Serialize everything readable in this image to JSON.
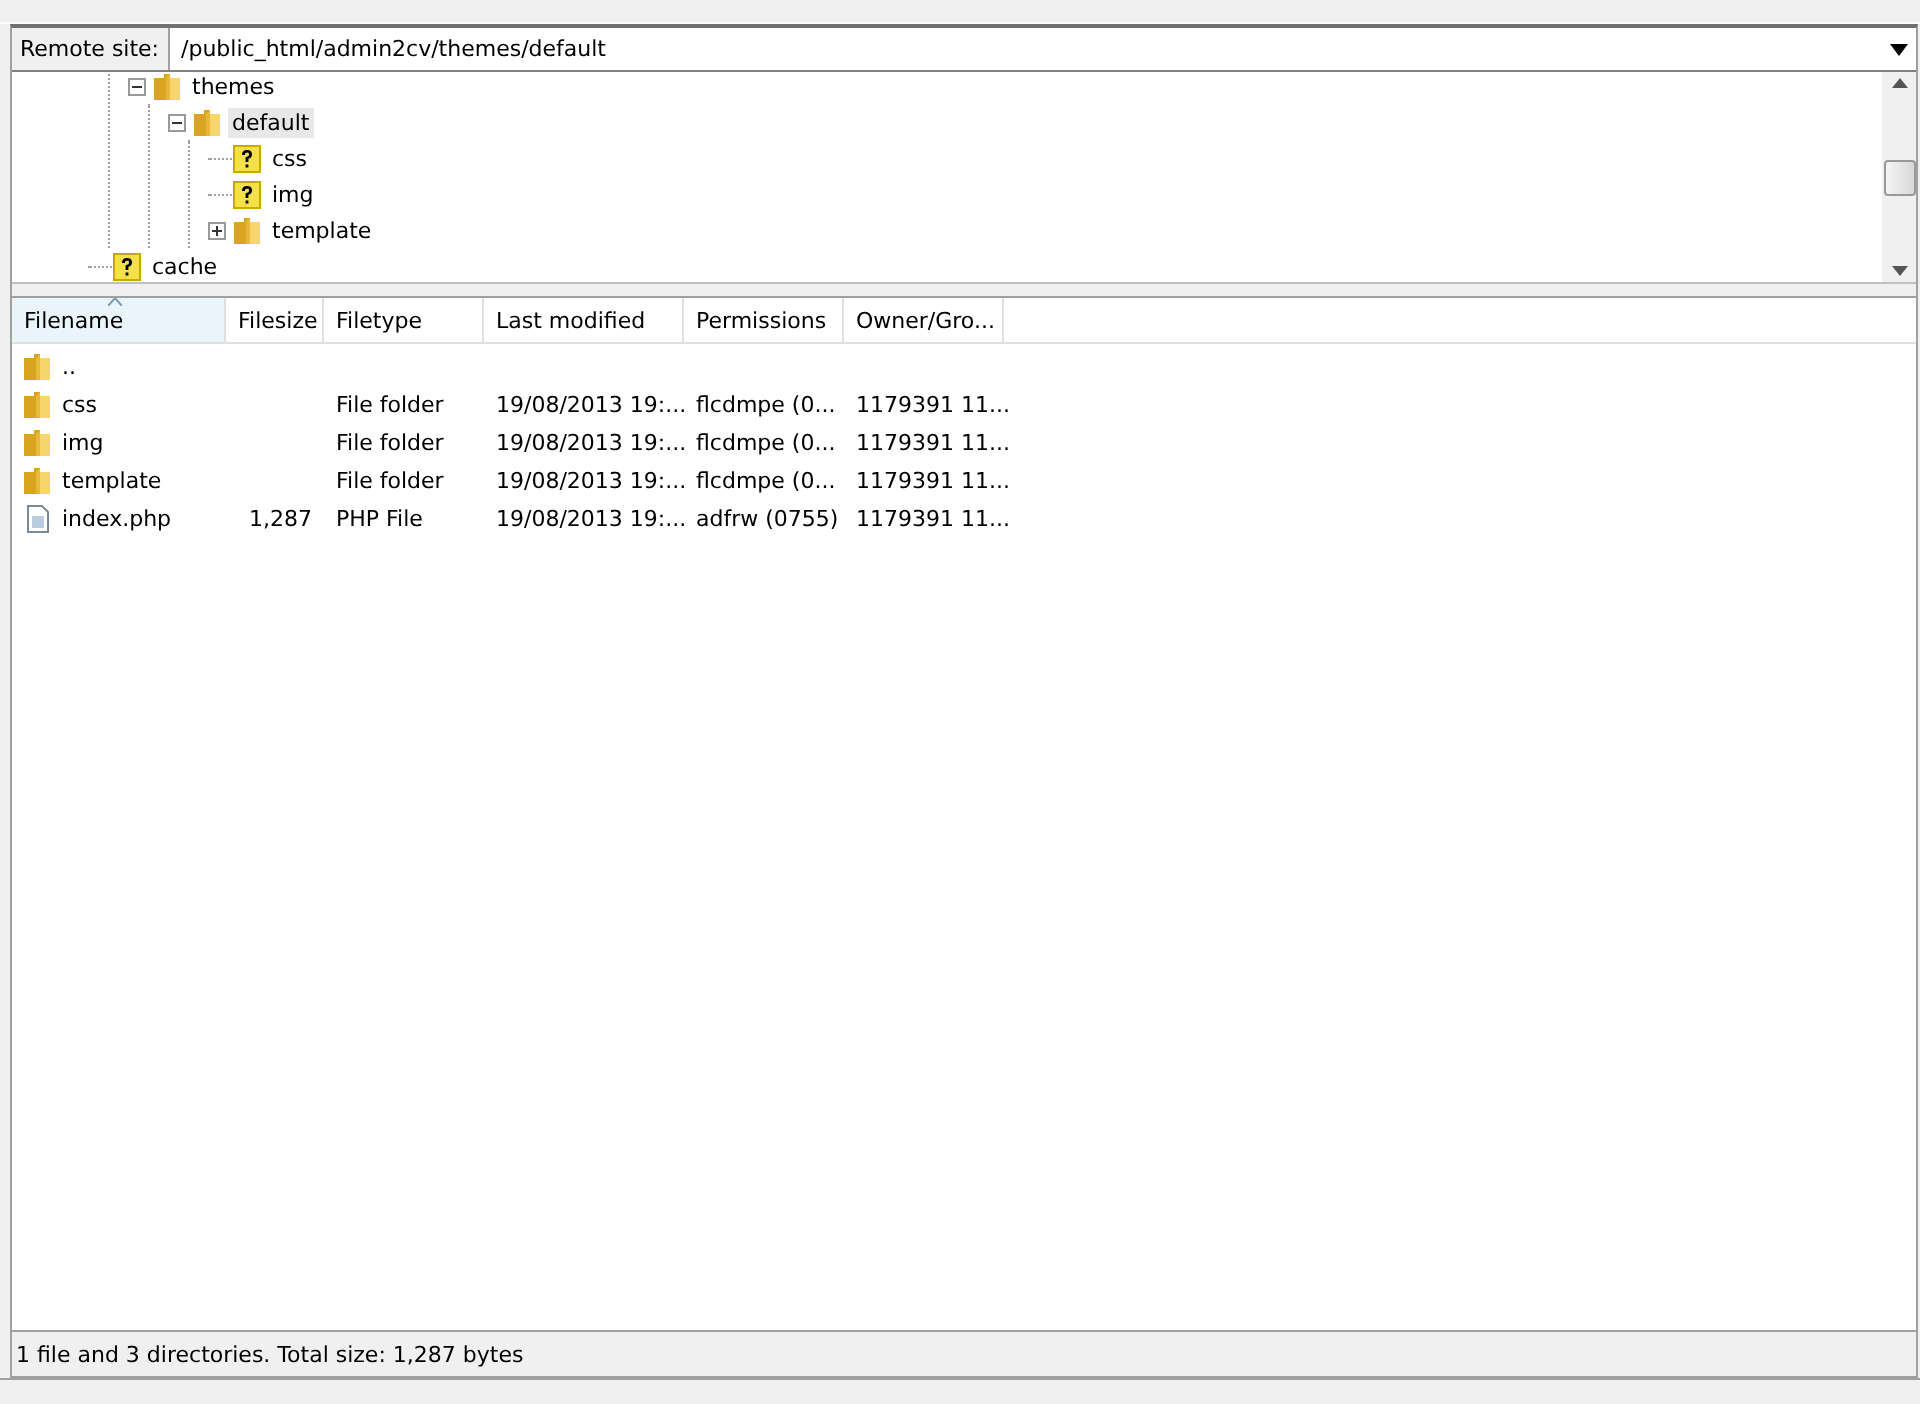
{
  "remote_site": {
    "label": "Remote site:",
    "path": "/public_html/admin2cv/themes/default"
  },
  "tree": {
    "items": [
      {
        "kind": "offscreen",
        "children": [
          {
            "label": "themes",
            "kind": "folder",
            "expanded": true,
            "selected": false,
            "children": [
              {
                "label": "default",
                "kind": "folder",
                "expanded": true,
                "selected": true,
                "children": [
                  {
                    "label": "css",
                    "kind": "unknown",
                    "selected": false
                  },
                  {
                    "label": "img",
                    "kind": "unknown",
                    "selected": false
                  },
                  {
                    "label": "template",
                    "kind": "folder",
                    "expanded": false,
                    "selected": false
                  }
                ]
              }
            ]
          }
        ]
      },
      {
        "label": "cache",
        "kind": "unknown",
        "selected": false
      }
    ]
  },
  "file_list": {
    "columns": [
      {
        "label": "Filename",
        "sorted": true
      },
      {
        "label": "Filesize",
        "sorted": false
      },
      {
        "label": "Filetype",
        "sorted": false
      },
      {
        "label": "Last modified",
        "sorted": false
      },
      {
        "label": "Permissions",
        "sorted": false
      },
      {
        "label": "Owner/Gro...",
        "sorted": false
      }
    ],
    "rows": [
      {
        "kind": "folder",
        "cells": [
          "..",
          "",
          "",
          "",
          "",
          ""
        ]
      },
      {
        "kind": "folder",
        "cells": [
          "css",
          "",
          "File folder",
          "19/08/2013 19:...",
          "flcdmpe (0...",
          "1179391 11..."
        ]
      },
      {
        "kind": "folder",
        "cells": [
          "img",
          "",
          "File folder",
          "19/08/2013 19:...",
          "flcdmpe (0...",
          "1179391 11..."
        ]
      },
      {
        "kind": "folder",
        "cells": [
          "template",
          "",
          "File folder",
          "19/08/2013 19:...",
          "flcdmpe (0...",
          "1179391 11..."
        ]
      },
      {
        "kind": "file",
        "cells": [
          "index.php",
          "1,287",
          "PHP File",
          "19/08/2013 19:...",
          "adfrw (0755)",
          "1179391 11..."
        ]
      }
    ]
  },
  "status_bar": "1 file and 3 directories. Total size: 1,287 bytes"
}
